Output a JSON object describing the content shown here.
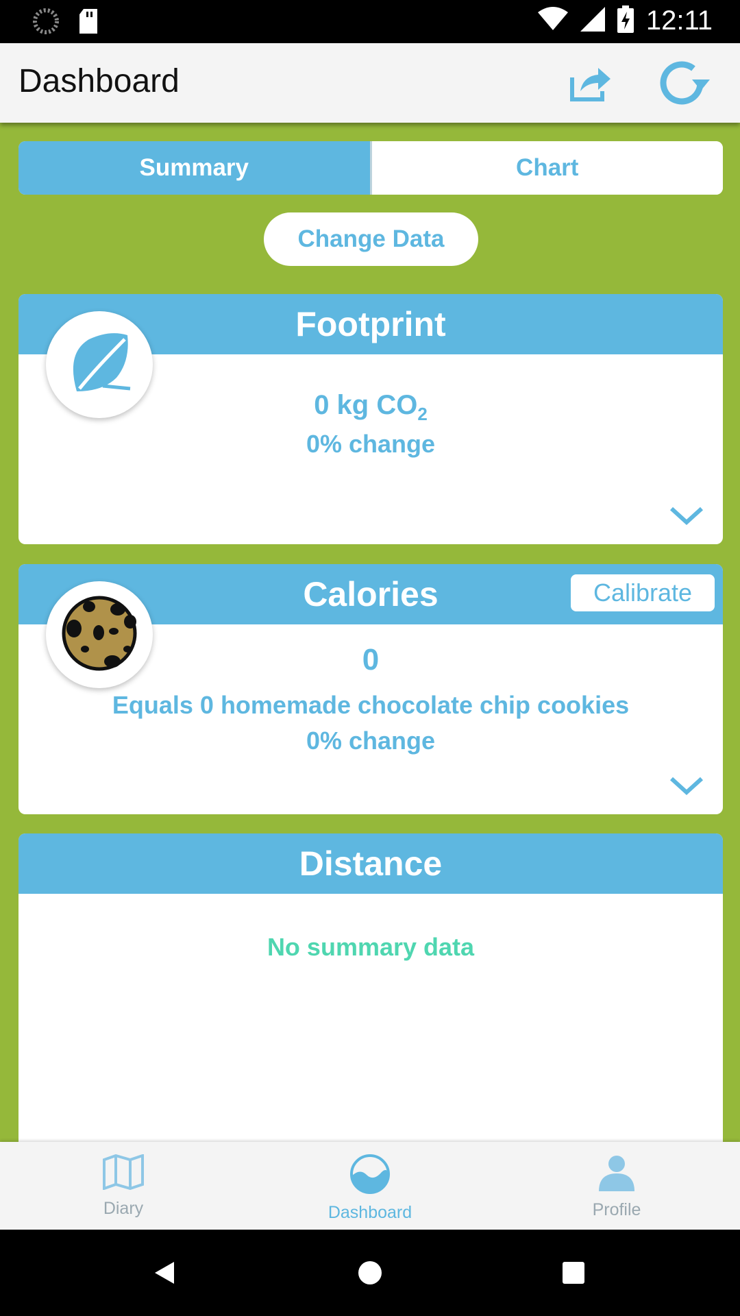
{
  "status_bar": {
    "time": "12:11"
  },
  "app_bar": {
    "title": "Dashboard",
    "share_icon": "share-icon",
    "refresh_icon": "refresh-icon"
  },
  "tabs": [
    {
      "label": "Summary",
      "active": true
    },
    {
      "label": "Chart",
      "active": false
    }
  ],
  "change_data_label": "Change Data",
  "footprint": {
    "title": "Footprint",
    "value": "0 kg CO",
    "value_subscript": "2",
    "change": "0% change"
  },
  "calories": {
    "title": "Calories",
    "calibrate_label": "Calibrate",
    "value": "0",
    "equals": "Equals 0 homemade chocolate chip cookies",
    "change": "0% change"
  },
  "distance": {
    "title": "Distance",
    "empty_text": "No summary data"
  },
  "bottom_nav": [
    {
      "label": "Diary",
      "icon": "map-icon"
    },
    {
      "label": "Dashboard",
      "icon": "dashboard-icon"
    },
    {
      "label": "Profile",
      "icon": "profile-icon"
    }
  ],
  "colors": {
    "accent": "#5eb7e0",
    "background": "#95b83a",
    "empty_text": "#4fd6b0",
    "nav_inactive": "#9aa8b0"
  }
}
